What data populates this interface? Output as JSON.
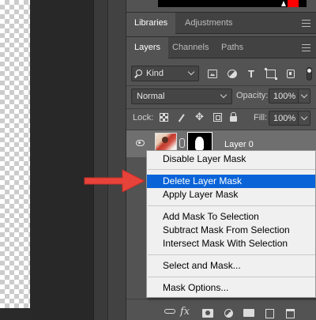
{
  "top_tabs": {
    "libraries": "Libraries",
    "adjustments": "Adjustments"
  },
  "layers_tabs": {
    "layers": "Layers",
    "channels": "Channels",
    "paths": "Paths"
  },
  "filter": {
    "kind_label": "Kind"
  },
  "blend": {
    "mode": "Normal",
    "opacity_label": "Opacity:",
    "opacity_value": "100%",
    "fill_label": "Fill:",
    "fill_value": "100%"
  },
  "lock": {
    "label": "Lock:"
  },
  "layer": {
    "name": "Layer 0"
  },
  "context_menu": {
    "items": [
      "Disable Layer Mask",
      "Delete Layer Mask",
      "Apply Layer Mask",
      "Add Mask To Selection",
      "Subtract Mask From Selection",
      "Intersect Mask With Selection",
      "Select and Mask...",
      "Mask Options..."
    ],
    "highlighted": "Delete Layer Mask"
  },
  "bottom_toolbar": {
    "fx_label": "fx"
  },
  "colors": {
    "panel_bg": "#535353",
    "tab_bar_bg": "#424242",
    "menu_highlight": "#0a64d8",
    "arrow_red": "#e8433a",
    "layer_row_selected": "#6f6f6f"
  }
}
